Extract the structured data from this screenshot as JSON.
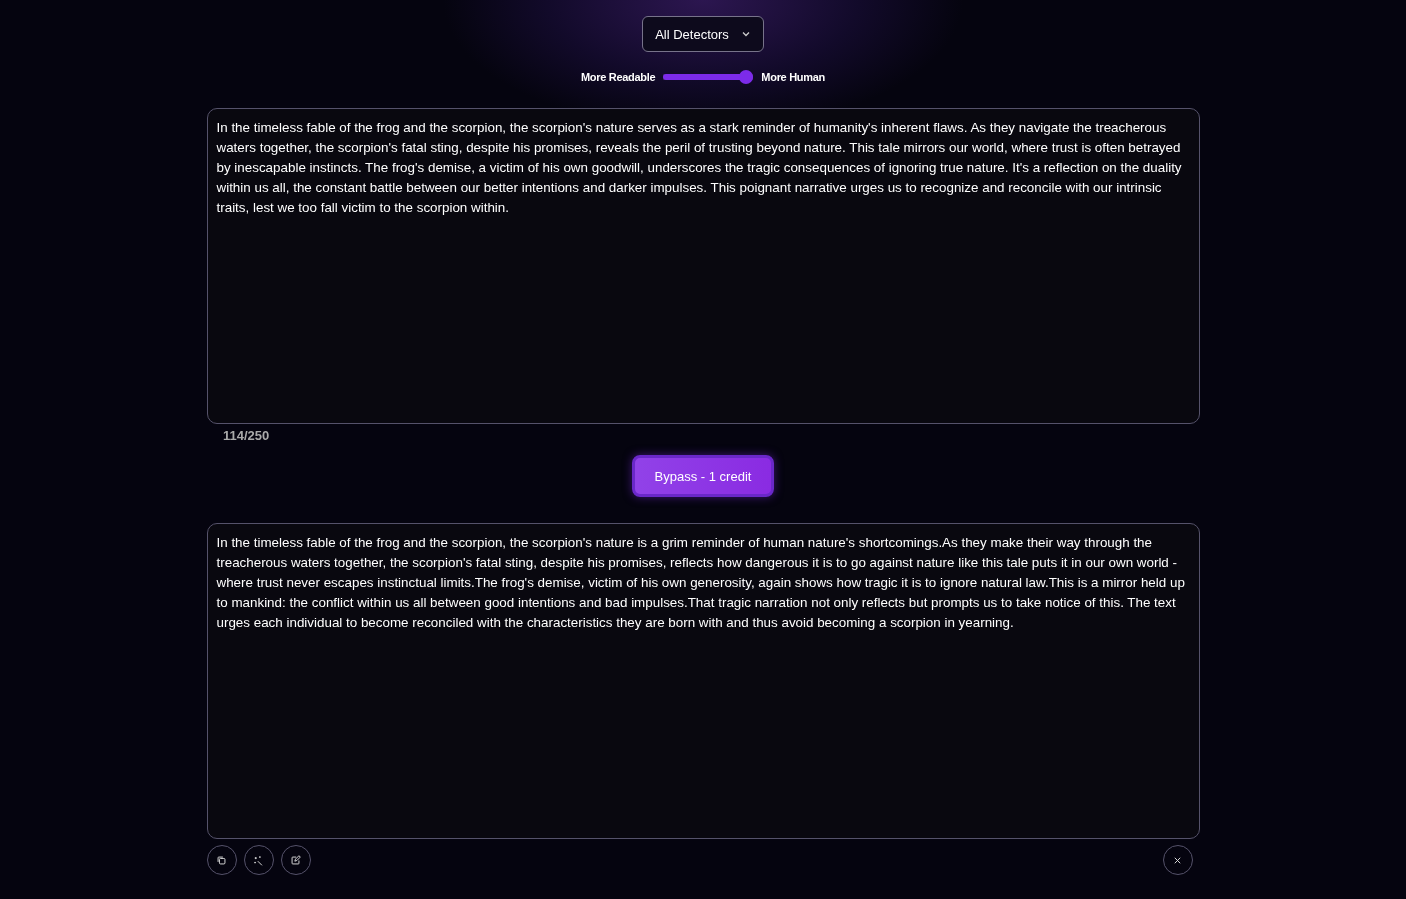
{
  "detector_dropdown": {
    "label": "All Detectors"
  },
  "humanizer_slider": {
    "left_label": "More Readable",
    "right_label": "More Human",
    "level": 1
  },
  "input": {
    "value": "In the timeless fable of the frog and the scorpion, the scorpion's nature serves as a stark reminder of humanity's inherent flaws. As they navigate the treacherous waters together, the scorpion's fatal sting, despite his promises, reveals the peril of trusting beyond nature. This tale mirrors our world, where trust is often betrayed by inescapable instincts. The frog's demise, a victim of his own goodwill, underscores the tragic consequences of ignoring true nature. It's a reflection on the duality within us all, the constant battle between our better intentions and darker impulses. This poignant narrative urges us to recognize and reconcile with our intrinsic traits, lest we too fall victim to the scorpion within.",
    "counter": "114/250"
  },
  "bypass_button": {
    "label": "Bypass - 1 credit"
  },
  "output": {
    "value": "In the timeless fable of the frog and the scorpion, the scorpion's nature is a grim reminder of human nature's shortcomings.As they make their way through the treacherous waters together, the scorpion's fatal sting, despite his promises, reflects how dangerous it is to go against nature like this tale puts it in our own world - where trust never escapes instinctual limits.The frog's demise, victim of his own generosity, again shows how tragic it is to ignore natural law.This is a mirror held up to mankind: the conflict within us all between good intentions and bad impulses.That tragic narration not only reflects but prompts us to take notice of this. The text urges each individual to become reconciled with the characteristics they are born with and thus avoid becoming a scorpion in yearning."
  },
  "output_actions": [
    {
      "kind": "copy"
    },
    {
      "kind": "magic"
    },
    {
      "kind": "edit"
    },
    {
      "kind": "close"
    }
  ]
}
